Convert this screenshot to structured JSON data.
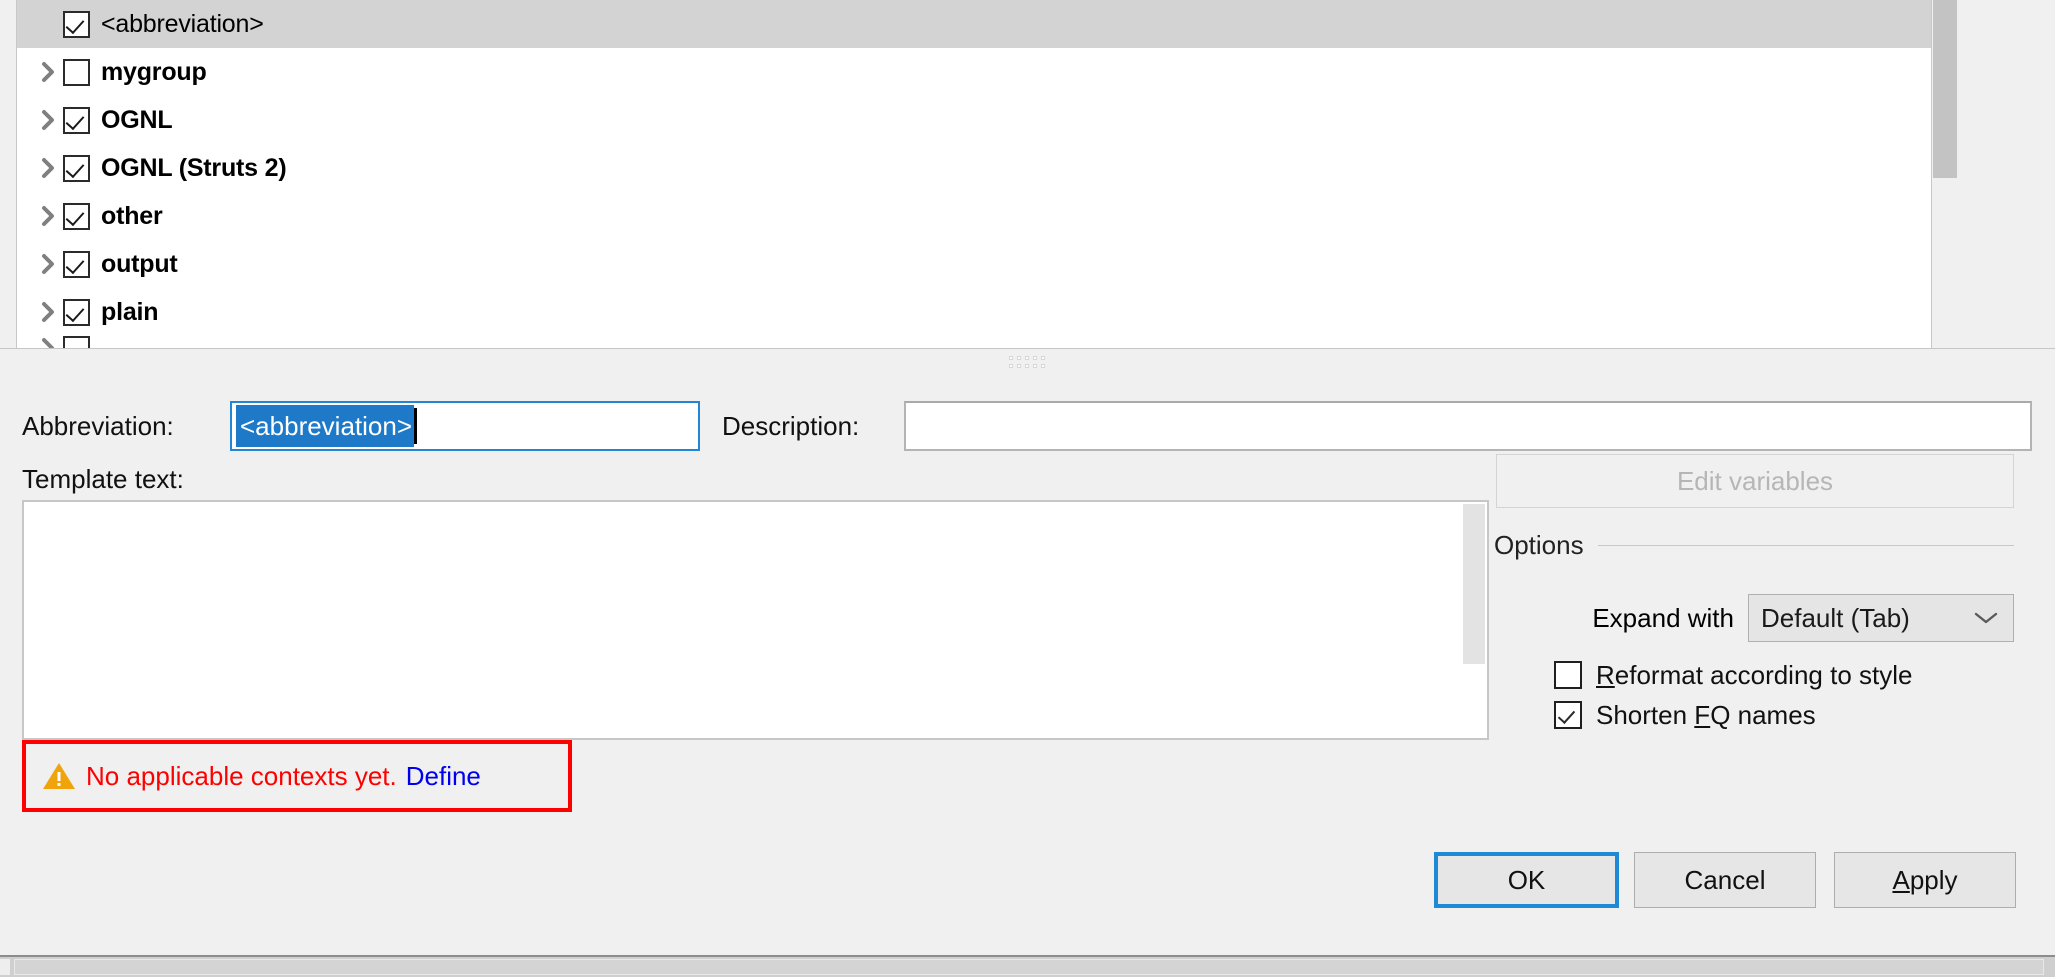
{
  "tree": {
    "rows": [
      {
        "label": "<abbreviation>",
        "checked": true,
        "selected": true,
        "expandable": false,
        "bold": false
      },
      {
        "label": "mygroup",
        "checked": false,
        "selected": false,
        "expandable": true,
        "bold": true
      },
      {
        "label": "OGNL",
        "checked": true,
        "selected": false,
        "expandable": true,
        "bold": true
      },
      {
        "label": "OGNL (Struts 2)",
        "checked": true,
        "selected": false,
        "expandable": true,
        "bold": true
      },
      {
        "label": "other",
        "checked": true,
        "selected": false,
        "expandable": true,
        "bold": true
      },
      {
        "label": "output",
        "checked": true,
        "selected": false,
        "expandable": true,
        "bold": true
      },
      {
        "label": "plain",
        "checked": true,
        "selected": false,
        "expandable": true,
        "bold": true
      }
    ],
    "scrollbar_name": "tree-vertical-scrollbar"
  },
  "form": {
    "abbreviation_label": "Abbreviation:",
    "abbreviation_value": "<abbreviation>",
    "description_label": "Description:",
    "description_value": "",
    "description_placeholder": "",
    "template_text_label": "Template text:",
    "template_text_value": ""
  },
  "warning": {
    "icon": "warning-triangle-icon",
    "message": "No applicable contexts yet.",
    "link": "Define",
    "border_color": "#ff0000",
    "text_color": "#ff0000",
    "link_color": "#0000ee"
  },
  "options": {
    "edit_variables_label": "Edit variables",
    "edit_variables_enabled": false,
    "group_title": "Options",
    "expand_with_label": "Expand with",
    "expand_with_value": "Default (Tab)",
    "expand_with_options": [
      "Default (Tab)"
    ],
    "reformat_label_pre": "",
    "reformat_mnemonic": "R",
    "reformat_label_post": "eformat according to style",
    "reformat_checked": false,
    "shorten_label_pre": "Shorten ",
    "shorten_mnemonic": "F",
    "shorten_label_post": "Q names",
    "shorten_checked": true
  },
  "buttons": {
    "ok": "OK",
    "cancel": "Cancel",
    "apply_pre": "",
    "apply_mnemonic": "A",
    "apply_post": "pply",
    "focus_color": "#1e8ad6"
  }
}
